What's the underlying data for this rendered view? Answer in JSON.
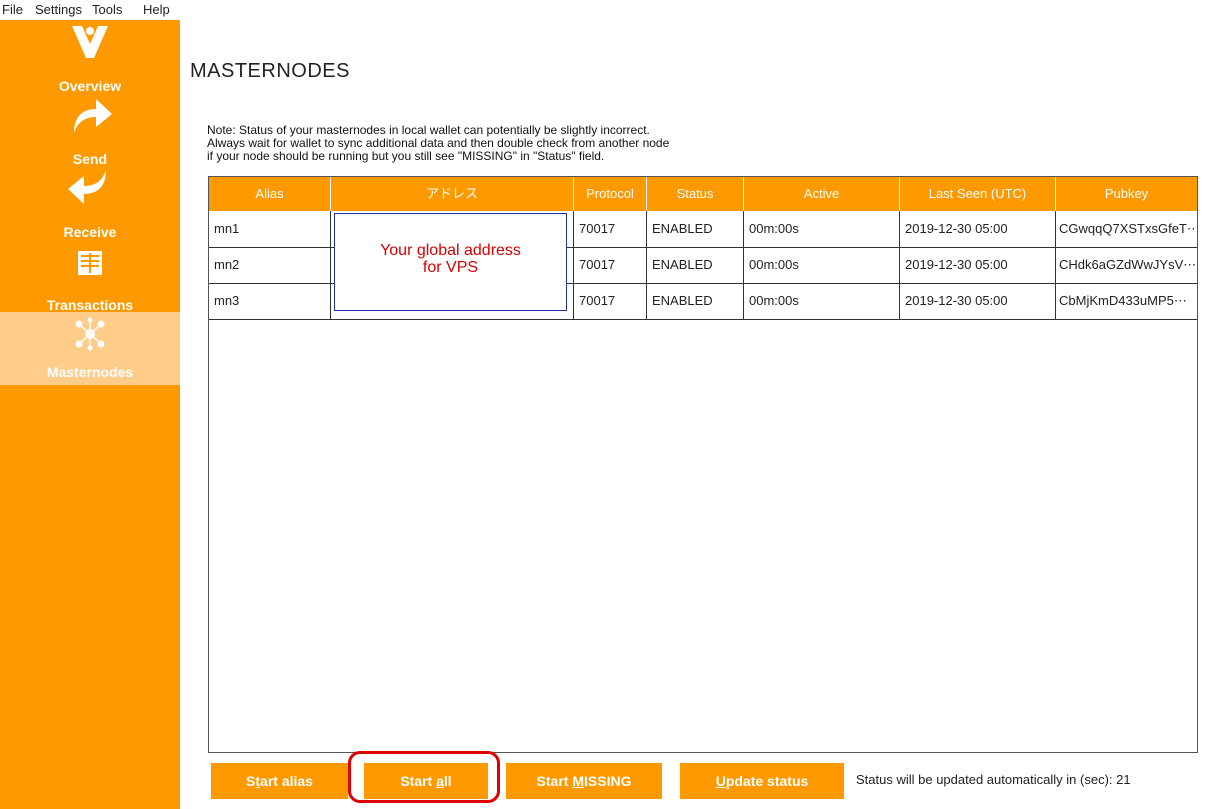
{
  "menu": [
    "File",
    "Settings",
    "Tools",
    "Help"
  ],
  "sidebar": {
    "items": [
      {
        "label": "Overview",
        "icon": "logo-icon"
      },
      {
        "label": "Send",
        "icon": "send-arrow-icon"
      },
      {
        "label": "Receive",
        "icon": "receive-arrow-icon"
      },
      {
        "label": "Transactions",
        "icon": "transactions-icon"
      },
      {
        "label": "Masternodes",
        "icon": "masternodes-icon"
      }
    ],
    "active": "Masternodes",
    "color": "#ff9900",
    "active_color": "#ffcc8a"
  },
  "page": {
    "title": "MASTERNODES",
    "note": [
      "Note: Status of your masternodes in local wallet can potentially be slightly incorrect.",
      "Always wait for wallet to sync additional data and then double check from another node",
      "if your node should be running but you still see \"MISSING\" in \"Status\" field."
    ]
  },
  "table": {
    "headers": [
      "Alias",
      "アドレス",
      "Protocol",
      "Status",
      "Active",
      "Last Seen (UTC)",
      "Pubkey"
    ],
    "rows": [
      [
        "mn1",
        "",
        "70017",
        "ENABLED",
        "00m:00s",
        "2019-12-30 05:00",
        "CGwqqQ7XSTxsGfeT⋯"
      ],
      [
        "mn2",
        "",
        "70017",
        "ENABLED",
        "00m:00s",
        "2019-12-30 05:00",
        "CHdk6aGZdWwJYsV⋯"
      ],
      [
        "mn3",
        "",
        "70017",
        "ENABLED",
        "00m:00s",
        "2019-12-30 05:00",
        "CbMjKmD433uMP5⋯"
      ]
    ]
  },
  "annotation": {
    "line1": "Your global address",
    "line2": "for VPS"
  },
  "buttons": {
    "start_alias": {
      "pre": "S",
      "ul": "t",
      "post": "art alias"
    },
    "start_all": {
      "pre": "Start ",
      "ul": "a",
      "post": "ll"
    },
    "start_missing": {
      "pre": "Start ",
      "ul": "M",
      "post": "ISSING"
    },
    "update_status": {
      "pre": "",
      "ul": "U",
      "post": "pdate status"
    }
  },
  "status_text": "Status will be updated automatically in (sec): 21"
}
